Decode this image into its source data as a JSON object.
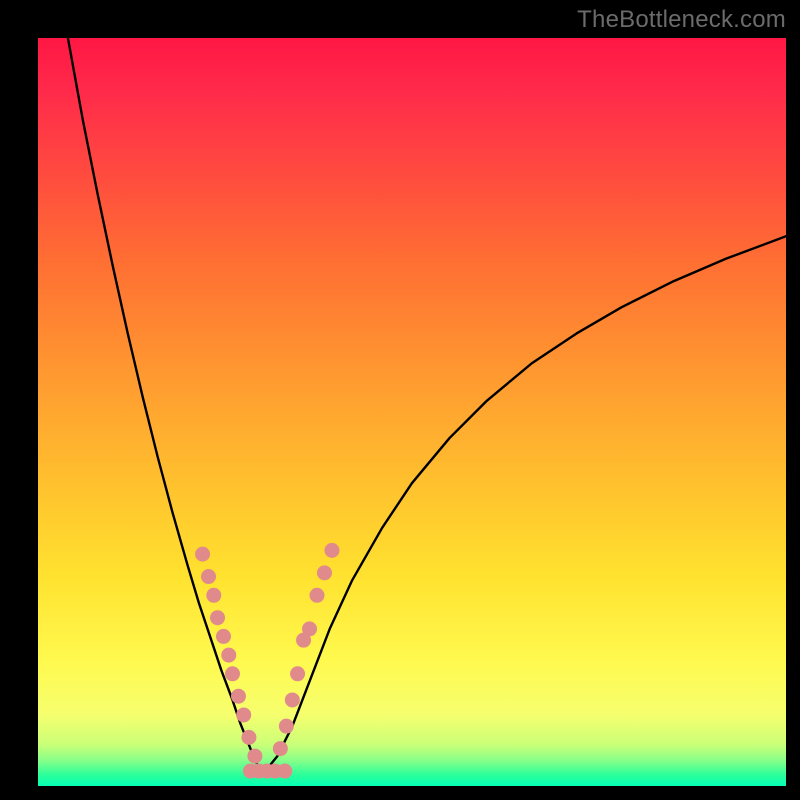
{
  "watermark": "TheBottleneck.com",
  "chart_data": {
    "type": "line",
    "title": "",
    "xlabel": "",
    "ylabel": "",
    "xlim": [
      0,
      100
    ],
    "ylim": [
      0,
      100
    ],
    "background_gradient": {
      "direction": "vertical",
      "stops": [
        {
          "offset": 0.0,
          "color": "#ff1744"
        },
        {
          "offset": 0.07,
          "color": "#ff2a4a"
        },
        {
          "offset": 0.18,
          "color": "#ff4a3f"
        },
        {
          "offset": 0.3,
          "color": "#ff6f33"
        },
        {
          "offset": 0.45,
          "color": "#ff9930"
        },
        {
          "offset": 0.6,
          "color": "#ffc22e"
        },
        {
          "offset": 0.72,
          "color": "#ffe22f"
        },
        {
          "offset": 0.83,
          "color": "#fff94e"
        },
        {
          "offset": 0.905,
          "color": "#f6ff6e"
        },
        {
          "offset": 0.945,
          "color": "#c9ff78"
        },
        {
          "offset": 0.965,
          "color": "#8bff88"
        },
        {
          "offset": 0.985,
          "color": "#2bff9a"
        },
        {
          "offset": 1.0,
          "color": "#05ffb5"
        }
      ]
    },
    "series": [
      {
        "name": "left-branch",
        "x": [
          4.0,
          6.0,
          8.0,
          10.0,
          12.0,
          14.0,
          16.0,
          18.0,
          20.0,
          21.5,
          23.0,
          24.5,
          26.0,
          27.0,
          28.0,
          29.0,
          30.0
        ],
        "y": [
          100.0,
          89.0,
          79.0,
          69.5,
          60.5,
          52.0,
          44.0,
          36.5,
          29.5,
          24.5,
          20.0,
          15.5,
          11.5,
          8.5,
          6.0,
          3.5,
          1.5
        ]
      },
      {
        "name": "right-branch",
        "x": [
          30.0,
          32.0,
          34.0,
          36.5,
          39.0,
          42.0,
          46.0,
          50.0,
          55.0,
          60.0,
          66.0,
          72.0,
          78.0,
          85.0,
          92.0,
          100.0
        ],
        "y": [
          1.5,
          4.0,
          8.0,
          14.5,
          21.0,
          27.5,
          34.5,
          40.5,
          46.5,
          51.5,
          56.5,
          60.5,
          64.0,
          67.5,
          70.5,
          73.5
        ]
      }
    ],
    "scatter": {
      "name": "markers",
      "color": "#e08a8c",
      "radius": 7,
      "points": [
        {
          "x": 22.0,
          "y": 31.0
        },
        {
          "x": 22.8,
          "y": 28.0
        },
        {
          "x": 23.5,
          "y": 25.5
        },
        {
          "x": 24.0,
          "y": 22.5
        },
        {
          "x": 24.8,
          "y": 20.0
        },
        {
          "x": 25.5,
          "y": 17.5
        },
        {
          "x": 26.0,
          "y": 15.0
        },
        {
          "x": 26.8,
          "y": 12.0
        },
        {
          "x": 27.5,
          "y": 9.5
        },
        {
          "x": 28.2,
          "y": 6.5
        },
        {
          "x": 29.0,
          "y": 4.0
        },
        {
          "x": 28.4,
          "y": 2.0
        },
        {
          "x": 29.5,
          "y": 2.0
        },
        {
          "x": 30.6,
          "y": 2.0
        },
        {
          "x": 31.7,
          "y": 2.0
        },
        {
          "x": 33.0,
          "y": 2.0
        },
        {
          "x": 32.4,
          "y": 5.0
        },
        {
          "x": 33.2,
          "y": 8.0
        },
        {
          "x": 34.0,
          "y": 11.5
        },
        {
          "x": 34.7,
          "y": 15.0
        },
        {
          "x": 35.5,
          "y": 19.5
        },
        {
          "x": 36.3,
          "y": 21.0
        },
        {
          "x": 37.3,
          "y": 25.5
        },
        {
          "x": 38.3,
          "y": 28.5
        },
        {
          "x": 39.3,
          "y": 31.5
        }
      ]
    }
  }
}
